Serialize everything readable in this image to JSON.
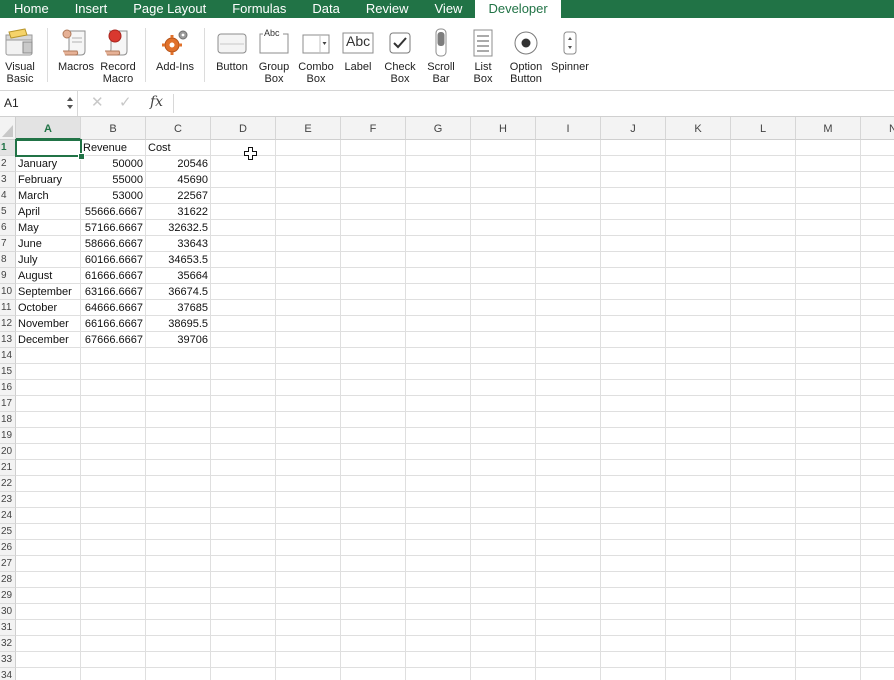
{
  "tabs": [
    {
      "label": "Home",
      "active": false
    },
    {
      "label": "Insert",
      "active": false
    },
    {
      "label": "Page Layout",
      "active": false
    },
    {
      "label": "Formulas",
      "active": false
    },
    {
      "label": "Data",
      "active": false
    },
    {
      "label": "Review",
      "active": false
    },
    {
      "label": "View",
      "active": false
    },
    {
      "label": "Developer",
      "active": true
    }
  ],
  "ribbon": {
    "visual_basic": [
      "Visual",
      "Basic"
    ],
    "macros": "Macros",
    "record_macro": [
      "Record",
      "Macro"
    ],
    "add_ins": "Add-Ins",
    "button": "Button",
    "group_box": [
      "Group",
      "Box"
    ],
    "group_box_glyph": "Abc",
    "combo_box": [
      "Combo",
      "Box"
    ],
    "label": "Label",
    "label_glyph": "Abc",
    "check_box": [
      "Check",
      "Box"
    ],
    "scroll_bar": [
      "Scroll",
      "Bar"
    ],
    "list_box": [
      "List",
      "Box"
    ],
    "option_button": [
      "Option",
      "Button"
    ],
    "spinner": "Spinner"
  },
  "formula_bar": {
    "name_box": "A1",
    "fx": "fx",
    "cancel_glyph": "✕",
    "enter_glyph": "✓",
    "formula": ""
  },
  "grid": {
    "columns": [
      "A",
      "B",
      "C",
      "D",
      "E",
      "F",
      "G",
      "H",
      "I",
      "J",
      "K",
      "L",
      "M",
      "N"
    ],
    "row_count": 35,
    "selected_column": "A",
    "selected_row": 1,
    "rows": [
      [
        "",
        "Revenue",
        "Cost"
      ],
      [
        "January",
        "50000",
        "20546"
      ],
      [
        "February",
        "55000",
        "45690"
      ],
      [
        "March",
        "53000",
        "22567"
      ],
      [
        "April",
        "55666.6667",
        "31622"
      ],
      [
        "May",
        "57166.6667",
        "32632.5"
      ],
      [
        "June",
        "58666.6667",
        "33643"
      ],
      [
        "July",
        "60166.6667",
        "34653.5"
      ],
      [
        "August",
        "61666.6667",
        "35664"
      ],
      [
        "September",
        "63166.6667",
        "36674.5"
      ],
      [
        "October",
        "64666.6667",
        "37685"
      ],
      [
        "November",
        "66166.6667",
        "38695.5"
      ],
      [
        "December",
        "67666.6667",
        "39706"
      ]
    ]
  },
  "colors": {
    "accent": "#217346",
    "record_red": "#d9382f",
    "addins_orange": "#e0712b"
  }
}
